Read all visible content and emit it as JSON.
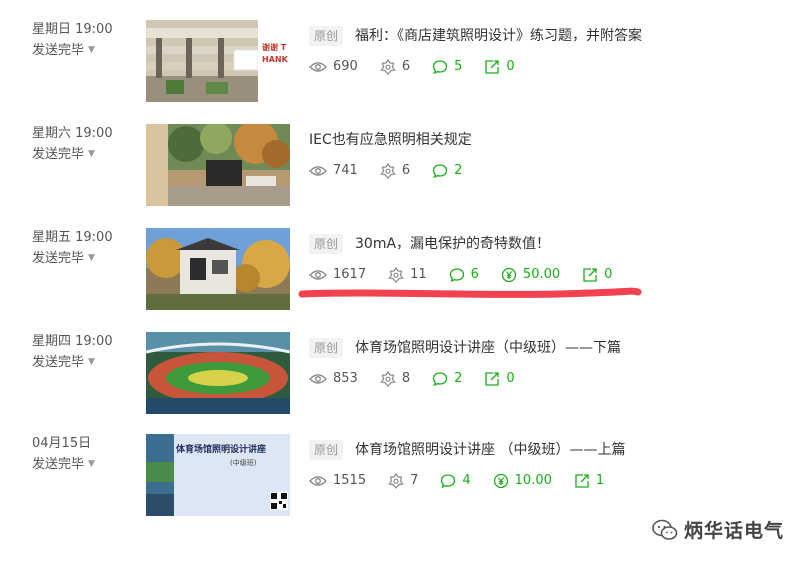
{
  "posts": [
    {
      "date": "星期日 19:00",
      "status": "发送完毕",
      "badge": "原创",
      "title": "福利：《商店建筑照明设计》练习题，并附答案",
      "thumb_text": "谢谢 THANK",
      "views": "690",
      "likes": "6",
      "comments": "5",
      "shares": "0"
    },
    {
      "date": "星期六 19:00",
      "status": "发送完毕",
      "badge": "",
      "title": "IEC也有应急照明相关规定",
      "views": "741",
      "likes": "6",
      "comments": "2"
    },
    {
      "date": "星期五 19:00",
      "status": "发送完毕",
      "badge": "原创",
      "title": "30mA，漏电保护的奇特数值！",
      "views": "1617",
      "likes": "11",
      "comments": "6",
      "reward": "50.00",
      "shares": "0"
    },
    {
      "date": "星期四 19:00",
      "status": "发送完毕",
      "badge": "原创",
      "title": "体育场馆照明设计讲座（中级班）——下篇",
      "views": "853",
      "likes": "8",
      "comments": "2",
      "shares": "0"
    },
    {
      "date": "04月15日",
      "status": "发送完毕",
      "badge": "原创",
      "title": "体育场馆照明设计讲座 （中级班）——上篇",
      "thumb_text": "体育场馆照明设计讲座",
      "thumb_sub": "(中级班)",
      "views": "1515",
      "likes": "7",
      "comments": "4",
      "reward": "10.00",
      "shares": "1"
    }
  ],
  "watermark": "炳华话电气",
  "colors": {
    "green": "#1aad19",
    "underline": "#f2414f",
    "gray": "#888888"
  }
}
